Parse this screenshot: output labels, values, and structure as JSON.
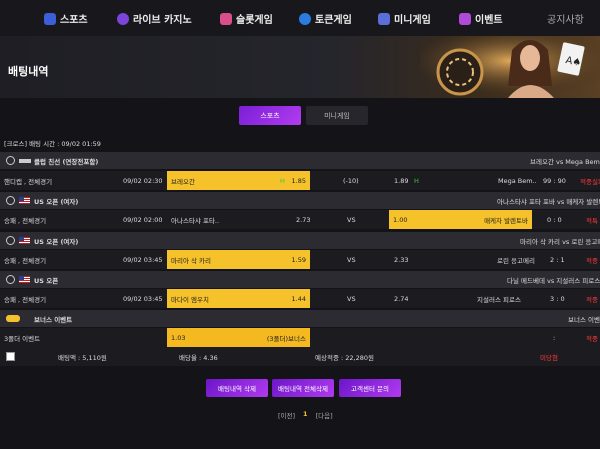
{
  "nav": {
    "items": [
      {
        "label": "스포츠",
        "color": "#3b5fd6"
      },
      {
        "label": "라이브 카지노",
        "color": "#7a45d8"
      },
      {
        "label": "슬롯게임",
        "color": "#d94f8c"
      },
      {
        "label": "토큰게임",
        "color": "#2b7be0"
      },
      {
        "label": "미니게임",
        "color": "#5a6fd8"
      },
      {
        "label": "이벤트",
        "color": "#b04ad8"
      }
    ],
    "notice": "공지사항"
  },
  "banner": {
    "title": "배팅내역"
  },
  "tabs": {
    "sports": "스포츠",
    "mini": "미니게임"
  },
  "crumb": "[크로스] 배팅 시간 : 09/02 01:59",
  "groups": [
    {
      "league": "클럽 친선 (연장전포함)",
      "match": "브레오간  vs  Mega Bemax",
      "row": {
        "type": "핸디캡 , 전체경기",
        "time": "09/02 02:30",
        "home": "브레오간",
        "home_odds": "1.85",
        "mid": "(-10)",
        "away_odds": "1.89",
        "away": "Mega Bem..",
        "score": "99 : 90",
        "result": "적중실패",
        "home_arrow": "H",
        "away_arrow": "H"
      }
    },
    {
      "league": "US 오픈 (여자)",
      "match": "아나스타샤 포타 포바  vs  매케자 발렌토바",
      "row": {
        "type": "승패 , 전체경기",
        "time": "09/02 02:00",
        "home": "아나스타샤 포타..",
        "home_odds": "2.73",
        "mid": "VS",
        "away_odds": "1.00",
        "away": "매케자 발렌토바",
        "score": "0 : 0",
        "result": "적특"
      }
    },
    {
      "league": "US 오픈 (여자)",
      "match": "마리아 삭 카리  vs  로린 응고메리",
      "row": {
        "type": "승패 , 전체경기",
        "time": "09/02 03:45",
        "home": "마리아 삭 카리",
        "home_odds": "1.59",
        "mid": "VS",
        "away_odds": "2.33",
        "away": "로린 응고메리",
        "score": "2 : 1",
        "result": "적중"
      }
    },
    {
      "league": "US 오픈",
      "match": "다닐 메드베데  vs  지설러스 피로스",
      "row": {
        "type": "승패 , 전체경기",
        "time": "09/02 03:45",
        "home": "마다이 엠우치",
        "home_odds": "1.44",
        "mid": "VS",
        "away_odds": "2.74",
        "away": "지설러스 피로스",
        "score": "3 : 0",
        "result": "적중"
      }
    }
  ],
  "bonus": {
    "title": "보너스 이벤트",
    "right": "보너스 이벤트",
    "type": "3폴더 이벤트",
    "odds": "1.03",
    "label": "(3폴더)보너스",
    "score": ":",
    "result": "적중"
  },
  "summary": {
    "bet": "배팅액 : 5,110원",
    "odds": "배당율 : 4.36",
    "expect": "예상적중 : 22,280원",
    "status": "미당첨"
  },
  "buttons": {
    "del": "배팅내역 삭제",
    "del_all": "배팅내역 전체삭제",
    "support": "고객센터 문의"
  },
  "pager": {
    "prev": "[이전]",
    "page": "1",
    "next": "[다음]"
  }
}
